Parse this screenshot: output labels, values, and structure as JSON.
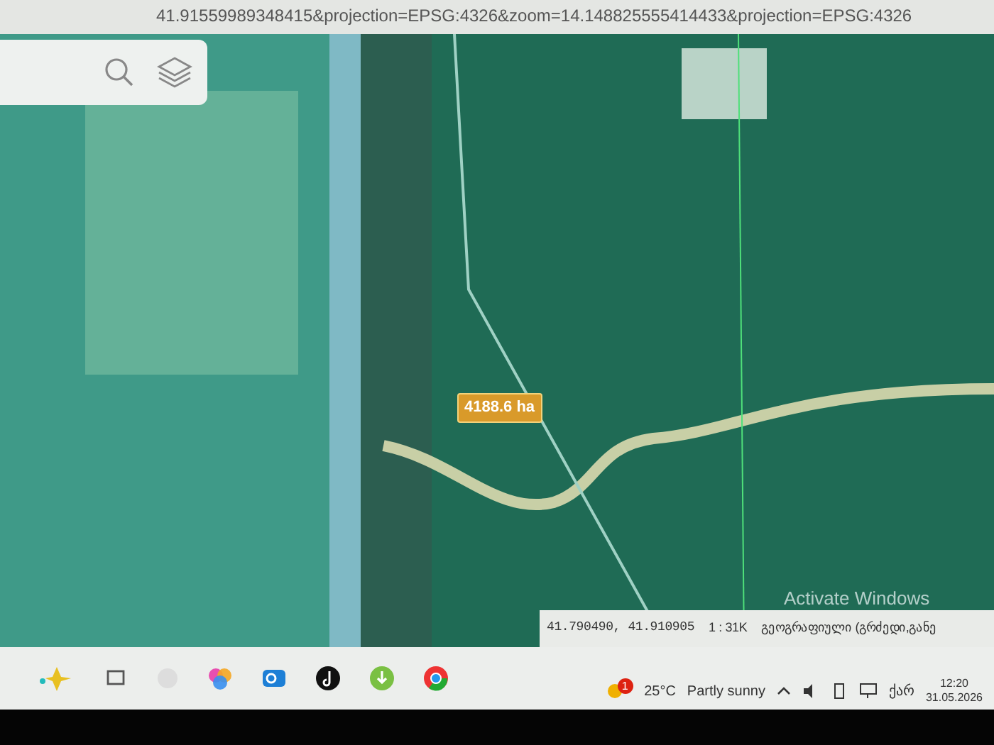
{
  "address_bar": {
    "url": "41.91559989348415&projection=EPSG:4326&zoom=14.148825555414433&projection=EPSG:4326"
  },
  "map": {
    "measurement": "4188.6 ha",
    "watermark_text": "Activate Windows"
  },
  "map_status": {
    "coordinates": "41.790490, 41.910905",
    "scale": "1 : 31K",
    "crs": "გეოგრაფიული (გრძედი,განე"
  },
  "taskbar": {
    "weather_temp": "25°C",
    "weather_text": "Partly sunny",
    "weather_alert": "1",
    "language": "ქარ",
    "time": "12:20",
    "date": "31.05.2026"
  }
}
